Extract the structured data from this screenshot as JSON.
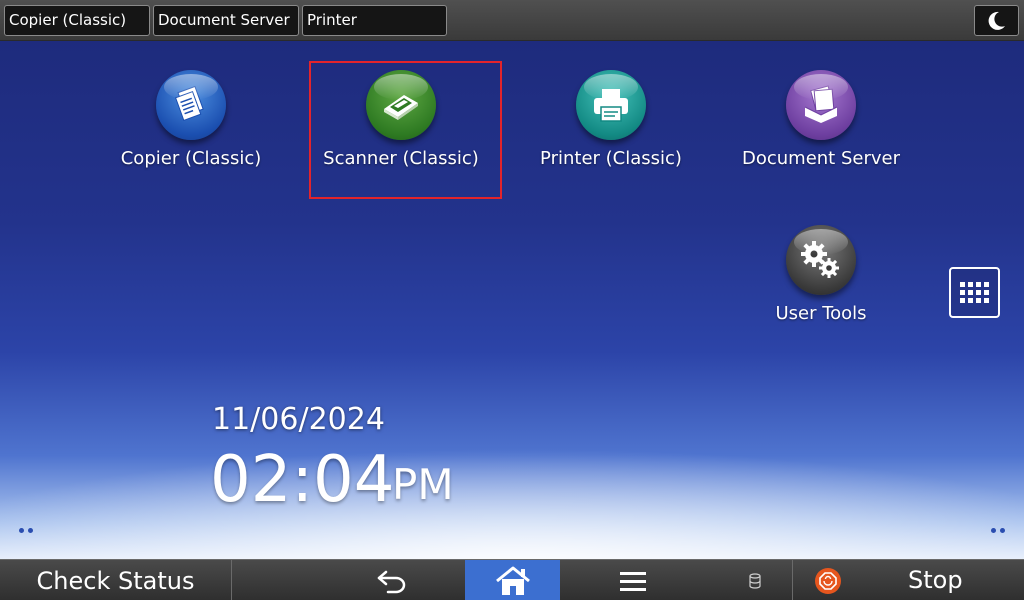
{
  "topbar": {
    "tabs": [
      {
        "label": "Copier (Classic)"
      },
      {
        "label": "Document Server"
      },
      {
        "label": "Printer"
      }
    ],
    "energy_icon": "moon-icon"
  },
  "apps": [
    {
      "label": "Copier (Classic)",
      "icon": "copier-icon",
      "color": "#1b4fb0"
    },
    {
      "label": "Scanner (Classic)",
      "icon": "scanner-icon",
      "color": "#2e7a22",
      "highlighted": true
    },
    {
      "label": "Printer (Classic)",
      "icon": "printer-icon",
      "color": "#138a84"
    },
    {
      "label": "Document Server",
      "icon": "document-server-icon",
      "color": "#6e3fa0"
    },
    {
      "label": "User Tools",
      "icon": "gears-icon",
      "color": "#3a3a3a"
    }
  ],
  "highlight_color": "#e3242b",
  "clock": {
    "date": "11/06/2024",
    "time": "02:04",
    "ampm": "PM"
  },
  "bottombar": {
    "check_status": "Check Status",
    "stop": "Stop",
    "home_active_color": "#3c6fd0",
    "stop_color": "#e6561e"
  }
}
